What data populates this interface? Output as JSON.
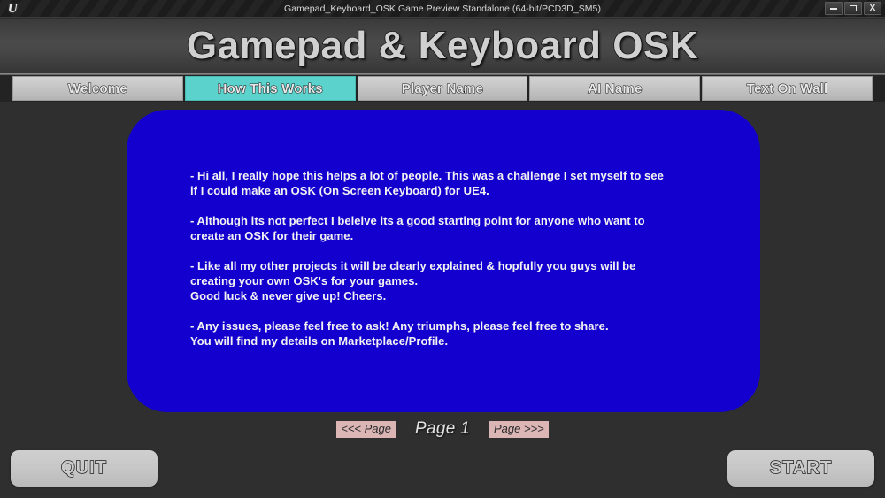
{
  "window": {
    "title": "Gamepad_Keyboard_OSK Game Preview Standalone (64-bit/PCD3D_SM5)",
    "logo_glyph": "U",
    "controls": {
      "minimize_label": "",
      "maximize_label": "",
      "close_label": "X"
    }
  },
  "header": {
    "title": "Gamepad & Keyboard OSK"
  },
  "tabs": [
    {
      "label": "Welcome",
      "active": false
    },
    {
      "label": "How This Works",
      "active": true
    },
    {
      "label": "Player Name",
      "active": false
    },
    {
      "label": "AI Name",
      "active": false
    },
    {
      "label": "Text On Wall",
      "active": false
    }
  ],
  "panel": {
    "background_color": "#1300cf",
    "paragraphs": [
      {
        "lines": [
          "- Hi all, I really hope this helps a lot of people. This was a challenge I set myself to see",
          "if I could make an OSK (On Screen Keyboard) for UE4."
        ]
      },
      {
        "lines": [
          "- Although its not perfect I beleive its a good starting point for anyone who want to",
          "create an OSK for their game."
        ]
      },
      {
        "lines": [
          "- Like all my other projects it will be clearly explained & hopfully you guys will be",
          "creating your own OSK's for your games.",
          "Good luck & never give up! Cheers."
        ]
      },
      {
        "lines": [
          "- Any issues, please feel free to ask! Any triumphs, please feel free to share.",
          "You will find my details on Marketplace/Profile."
        ]
      }
    ]
  },
  "pagination": {
    "prev_label": "<<< Page",
    "current_label": "Page 1",
    "next_label": "Page >>>",
    "button_color": "#dcb5b5"
  },
  "actions": {
    "quit_label": "QUIT",
    "start_label": "START"
  },
  "theme": {
    "accent_cyan": "#5cd2cd",
    "panel_blue": "#1300cf",
    "tab_gray": "#c4c4c4",
    "background": "#2f2f2f"
  }
}
